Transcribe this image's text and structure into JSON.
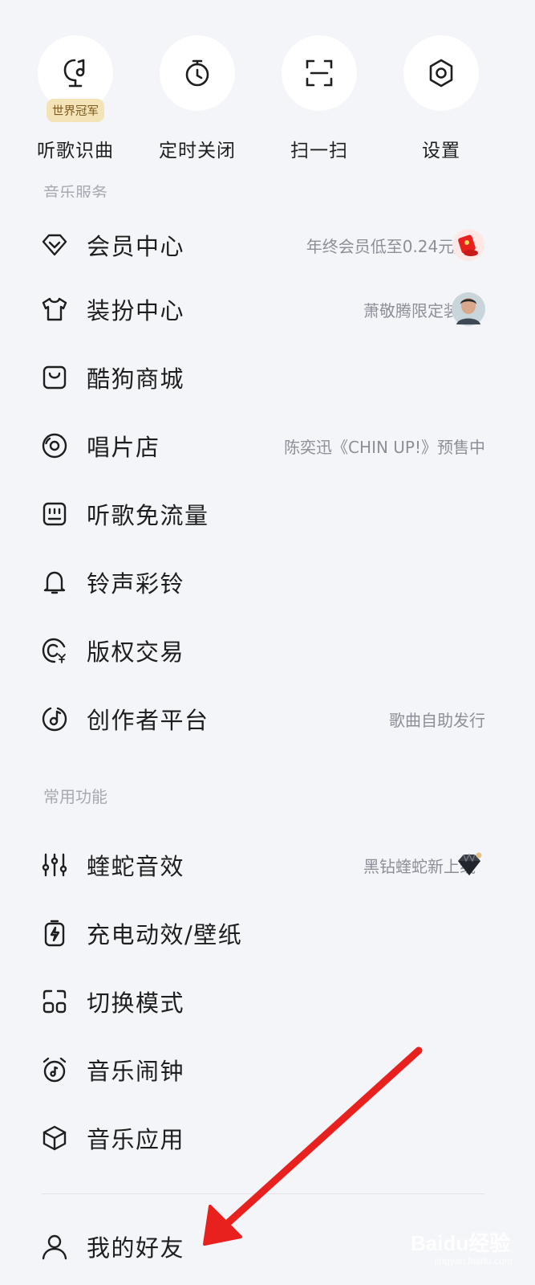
{
  "quick_actions": [
    {
      "label": "听歌识曲",
      "icon": "mic-music-icon",
      "badge": "世界冠军"
    },
    {
      "label": "定时关闭",
      "icon": "timer-icon"
    },
    {
      "label": "扫一扫",
      "icon": "scan-icon"
    },
    {
      "label": "设置",
      "icon": "gear-icon"
    }
  ],
  "sections": {
    "music_services": {
      "title": "音乐服务",
      "items": [
        {
          "label": "会员中心",
          "sub": "年终会员低至0.24元/天",
          "icon": "diamond-icon",
          "thumb": "red-envelope-icon"
        },
        {
          "label": "装扮中心",
          "sub": "萧敬腾限定装扮",
          "icon": "tshirt-icon",
          "thumb": "avatar"
        },
        {
          "label": "酷狗商城",
          "sub": "",
          "icon": "shopping-bag-icon"
        },
        {
          "label": "唱片店",
          "sub": "陈奕迅《CHIN UP!》预售中",
          "icon": "vinyl-record-icon"
        },
        {
          "label": "听歌免流量",
          "sub": "",
          "icon": "sim-card-icon"
        },
        {
          "label": "铃声彩铃",
          "sub": "",
          "icon": "bell-icon"
        },
        {
          "label": "版权交易",
          "sub": "",
          "icon": "copyright-yen-icon"
        },
        {
          "label": "创作者平台",
          "sub": "歌曲自助发行",
          "icon": "music-note-circle-icon"
        }
      ]
    },
    "common_functions": {
      "title": "常用功能",
      "items": [
        {
          "label": "蝰蛇音效",
          "sub": "黑钻蝰蛇新上线",
          "icon": "equalizer-icon",
          "thumb": "black-diamond-icon"
        },
        {
          "label": "充电动效/壁纸",
          "sub": "",
          "icon": "charging-icon"
        },
        {
          "label": "切换模式",
          "sub": "",
          "icon": "switch-mode-icon"
        },
        {
          "label": "音乐闹钟",
          "sub": "",
          "icon": "alarm-clock-icon"
        },
        {
          "label": "音乐应用",
          "sub": "",
          "icon": "cube-icon"
        }
      ]
    },
    "friends": {
      "items": [
        {
          "label": "我的好友",
          "icon": "user-icon"
        }
      ]
    }
  },
  "watermark": {
    "main": "Baidu经验",
    "sub": "jingyan.baidu.com"
  },
  "colors": {
    "background": "#f4f5f9",
    "annotation_arrow": "#e8211f",
    "badge_bg": "#f4e3b6"
  }
}
